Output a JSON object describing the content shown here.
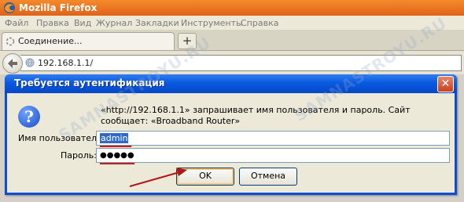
{
  "browser": {
    "title": "Mozilla Firefox",
    "menu": [
      "Файл",
      "Правка",
      "Вид",
      "Журнал",
      "Закладки",
      "Инструменты",
      "Справка"
    ],
    "tab_label": "Соединение...",
    "new_tab": "+",
    "url": "192.168.1.1/"
  },
  "watermark": "SAMNASTROYU.RU",
  "dialog": {
    "title": "Требуется аутентификация",
    "close": "✕",
    "message": "«http://192.168.1.1» запрашивает имя пользователя и пароль. Сайт сообщает: «Broadband Router»",
    "username_label": "Имя пользователя:",
    "username_value": "admin",
    "password_label": "Пароль:",
    "password_value": "●●●●●",
    "ok_label": "OK",
    "cancel_label": "Отмена",
    "icon": "question-icon"
  },
  "colors": {
    "accent_red": "#cc1a1a",
    "dialog_blue": "#0a4ed8",
    "firefox_orange": "#e2621a"
  }
}
